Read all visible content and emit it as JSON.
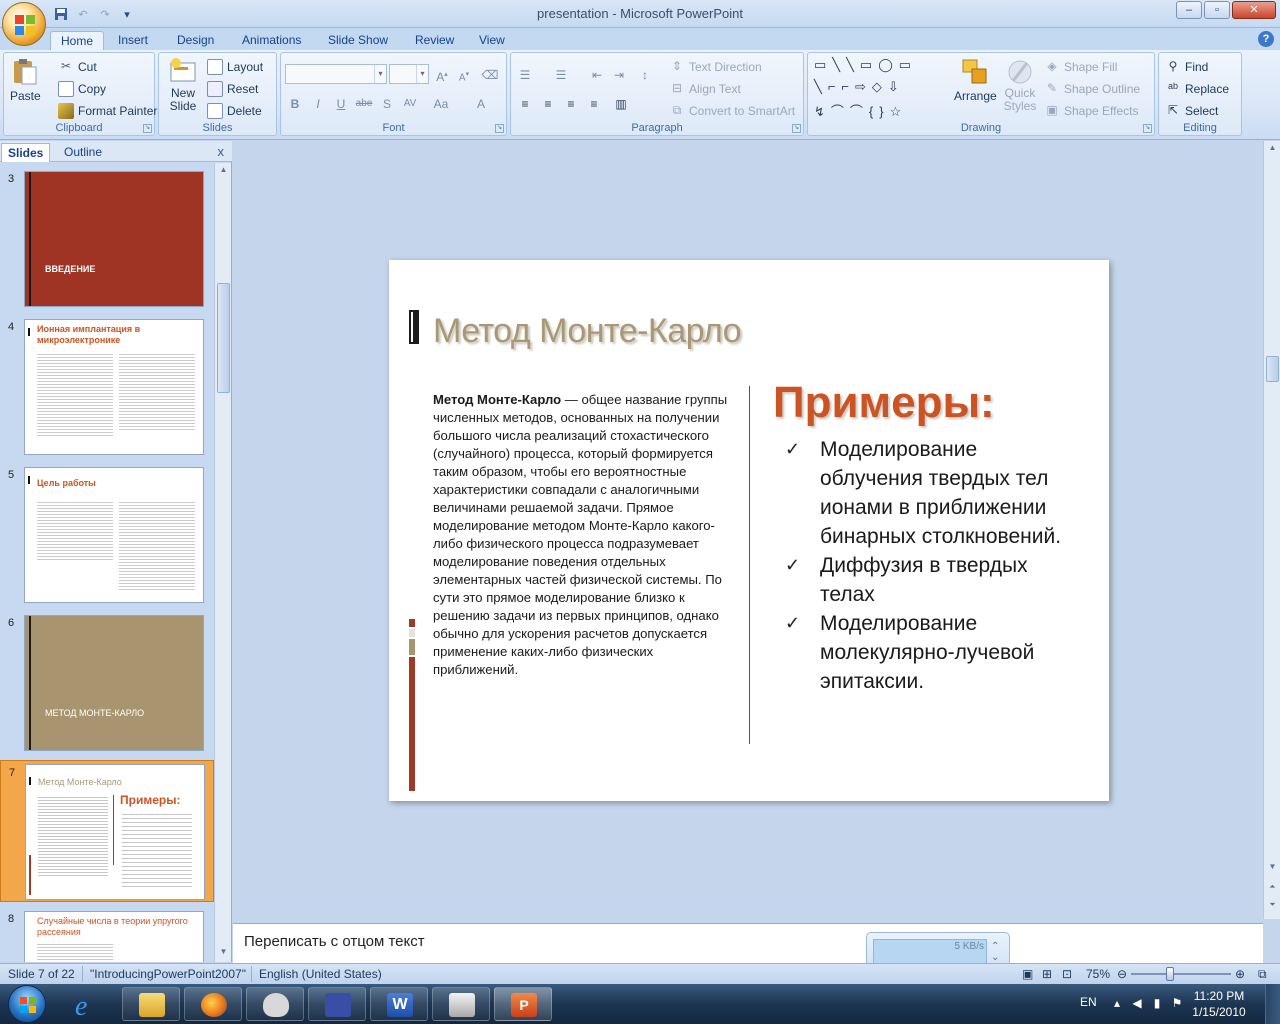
{
  "window": {
    "title": "presentation - Microsoft PowerPoint",
    "controls": [
      "minimize",
      "maximize",
      "close"
    ]
  },
  "quick_access": [
    "save-icon",
    "undo-icon",
    "redo-icon",
    "customize-icon"
  ],
  "ribbon": {
    "tabs": [
      "Home",
      "Insert",
      "Design",
      "Animations",
      "Slide Show",
      "Review",
      "View"
    ],
    "active_tab": "Home",
    "groups": {
      "clipboard": {
        "label": "Clipboard",
        "paste": "Paste",
        "cut": "Cut",
        "copy": "Copy",
        "format_painter": "Format Painter"
      },
      "slides": {
        "label": "Slides",
        "new_slide": "New Slide",
        "new_slide_arrow": "▾",
        "layout": "Layout",
        "reset": "Reset",
        "delete": "Delete"
      },
      "font": {
        "label": "Font"
      },
      "paragraph": {
        "label": "Paragraph",
        "text_direction": "Text Direction",
        "align_text": "Align Text",
        "convert_smartart": "Convert to SmartArt"
      },
      "drawing": {
        "label": "Drawing",
        "arrange": "Arrange",
        "quick_styles": "Quick Styles",
        "shape_fill": "Shape Fill",
        "shape_outline": "Shape Outline",
        "shape_effects": "Shape Effects"
      },
      "editing": {
        "label": "Editing",
        "find": "Find",
        "replace": "Replace",
        "select": "Select"
      }
    }
  },
  "panel": {
    "tabs": [
      "Slides",
      "Outline"
    ],
    "active_tab": "Slides",
    "close": "x",
    "thumbnails": [
      {
        "num": "3",
        "title": "ВВЕДЕНИЕ",
        "style": "section-red"
      },
      {
        "num": "4",
        "title": "Ионная имплантация в микроэлектронике",
        "style": "content"
      },
      {
        "num": "5",
        "title": "Цель работы",
        "style": "content"
      },
      {
        "num": "6",
        "title": "МЕТОД МОНТЕ-КАРЛО",
        "style": "section-tan"
      },
      {
        "num": "7",
        "title": "Метод Монте-Карло",
        "style": "content-selected",
        "subtitle": "Примеры:"
      },
      {
        "num": "8",
        "title": "Случайные числа в теории упругого рассеяния",
        "style": "content"
      }
    ]
  },
  "slide": {
    "title": "Метод Монте-Карло",
    "body_bold": "Метод Монте-Карло",
    "body_rest": " — общее название группы численных методов, основанных на получении большого числа реализаций стохастического (случайного) процесса, который формируется таким образом, чтобы его вероятностные характеристики совпадали с аналогичными величинами решаемой задачи. Прямое моделирование методом Монте-Карло какого-либо физического процесса подразумевает моделирование поведения отдельных элементарных частей физической системы. По сути это прямое моделирование близко к решению задачи из первых принципов, однако обычно для ускорения расчетов допускается применение каких-либо физических приближений.",
    "examples_title": "Примеры:",
    "examples": [
      "Моделирование облучения твердых тел ионами в приближении бинарных столкновений.",
      "Диффузия в твердых телах",
      "Моделирование молекулярно-лучевой эпитаксии."
    ],
    "check_glyph": "✓"
  },
  "notes": {
    "text": "Переписать с отцом текст"
  },
  "net_widget": {
    "speed": "5 KB/s"
  },
  "status": {
    "slide": "Slide 7 of 22",
    "theme": "\"IntroducingPowerPoint2007\"",
    "language": "English (United States)",
    "zoom": "75%",
    "zoom_level": 0.75
  },
  "taskbar": {
    "apps": [
      "internet-explorer",
      "windows-explorer",
      "firefox",
      "alienware",
      "save-app",
      "word",
      "printer",
      "powerpoint"
    ],
    "active_app": "powerpoint",
    "lang": "EN",
    "time": "11:20 PM",
    "date": "1/15/2010"
  },
  "colors": {
    "accent_red": "#a03a28",
    "title_tan": "#a89878",
    "examples_orange": "#cc5422",
    "ribbon_text": "#15428b"
  }
}
